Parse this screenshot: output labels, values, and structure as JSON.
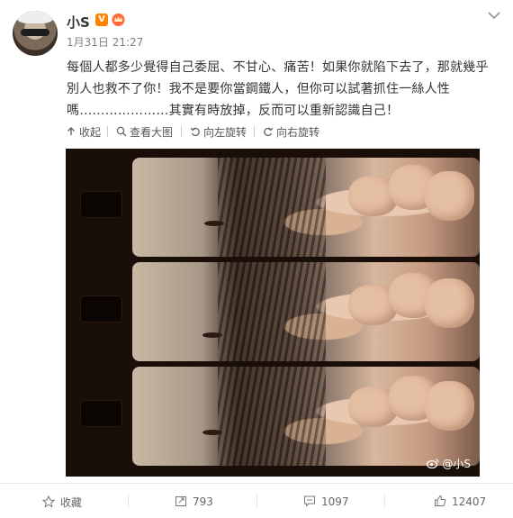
{
  "post": {
    "username": "小S",
    "verified_badge": "V",
    "timestamp": "1月31日 21:27",
    "text": "每個人都多少覺得自己委屈、不甘心、痛苦！如果你就陷下去了，那就幾乎別人也救不了你！我不是要你當鋼鐵人，但你可以試著抓住一絲人性嗎…………………其實有時放掉，反而可以重新認識自己！"
  },
  "toolbar": {
    "collapse": "收起",
    "view_large": "查看大图",
    "rotate_left": "向左旋转",
    "rotate_right": "向右旋转"
  },
  "image": {
    "watermark": "@小S"
  },
  "footer": {
    "favorite": "收藏",
    "reposts": "793",
    "comments": "1097",
    "likes": "12407"
  },
  "colors": {
    "verified": "#ff8200",
    "text": "#333333",
    "muted": "#808080"
  }
}
